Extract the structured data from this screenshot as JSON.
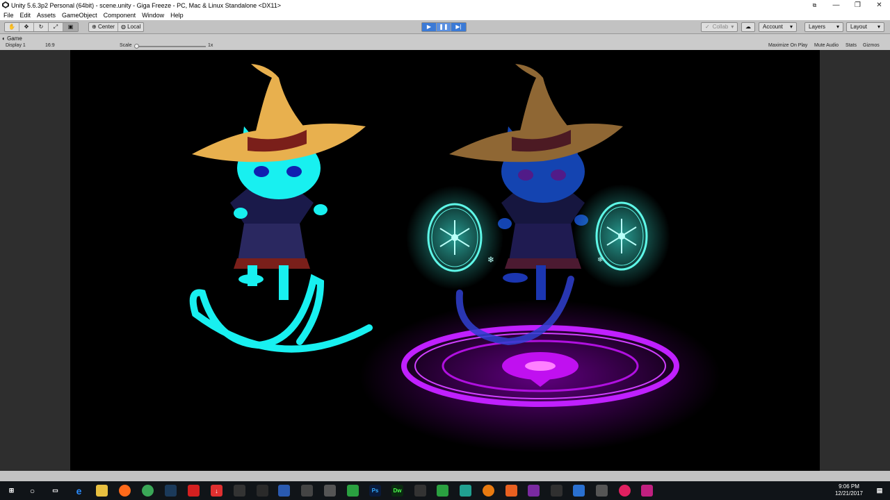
{
  "window": {
    "title": "Unity 5.6.3p2 Personal (64bit) - scene.unity - Giga Freeze - PC, Mac & Linux Standalone <DX11>",
    "minimize": "—",
    "maximize": "❐",
    "close": "✕"
  },
  "menu": [
    "File",
    "Edit",
    "Assets",
    "GameObject",
    "Component",
    "Window",
    "Help"
  ],
  "toolbar": {
    "pivot_center": "Center",
    "pivot_local": "Local",
    "collab": "Collab",
    "account": "Account",
    "layers": "Layers",
    "layout": "Layout"
  },
  "game_panel": {
    "tab": "Game",
    "display": "Display 1",
    "aspect": "16:9",
    "scale_label": "Scale",
    "scale_value": "1x",
    "maximize_on_play": "Maximize On Play",
    "mute_audio": "Mute Audio",
    "stats": "Stats",
    "gizmos": "Gizmos"
  },
  "taskbar": {
    "time": "9:06 PM",
    "date": "12/21/2017",
    "apps": [
      "start-icon",
      "cortana-icon",
      "task-view-icon",
      "edge-icon",
      "file-explorer-icon",
      "firefox-icon",
      "chrome-icon",
      "steam-icon",
      "app-red-icon",
      "download-icon",
      "app-gray-icon",
      "app-gray2-icon",
      "app-blue-icon",
      "app-gray3-icon",
      "app-gray4-icon",
      "app-green-icon",
      "photoshop-icon",
      "dreamweaver-icon",
      "app-gray5-icon",
      "app-green2-icon",
      "app-teal-icon",
      "blender-icon",
      "app-orange-icon",
      "onenote-icon",
      "unity-icon",
      "app-blue2-icon",
      "app-gray6-icon",
      "itunes-icon",
      "app-pink-icon"
    ],
    "photoshop_label": "Ps",
    "dreamweaver_label": "Dw"
  }
}
